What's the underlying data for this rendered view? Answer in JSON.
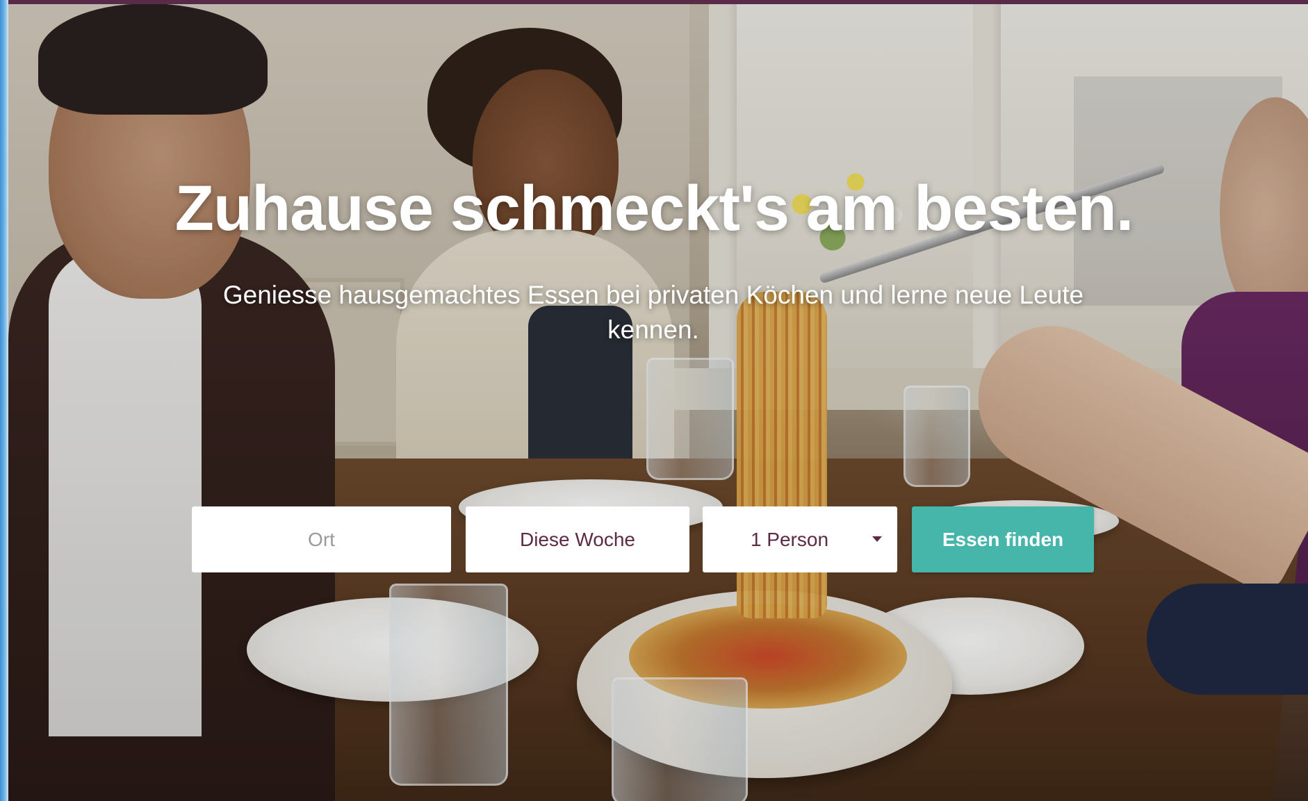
{
  "hero": {
    "title": "Zuhause schmeckt's am besten.",
    "subtitle": "Geniesse hausgemachtes Essen bei privaten Köchen und lerne neue Leute kennen."
  },
  "search": {
    "location_placeholder": "Ort",
    "location_value": "",
    "date_value": "Diese Woche",
    "persons_value": "1 Person",
    "submit_label": "Essen finden"
  },
  "colors": {
    "accent": "#46b5aa",
    "brand_text": "#5d2a44",
    "top_strip": "#5a2b48",
    "placeholder": "#9a9a9a"
  },
  "icons": {
    "persons_dropdown": "caret-down-icon"
  }
}
